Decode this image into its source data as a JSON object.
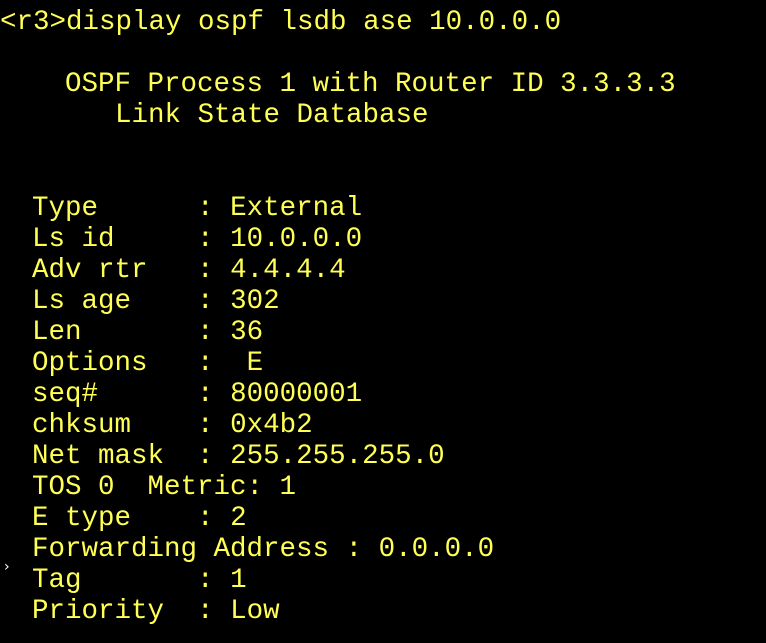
{
  "terminal": {
    "text_color": "#ffff55",
    "background": "#000000",
    "prompt": "<r3>",
    "command": "display ospf lsdb ase 10.0.0.0",
    "header": {
      "process_line": "OSPF Process 1 with Router ID 3.3.3.3",
      "db_title": "Link State Database"
    },
    "fields": [
      {
        "label": "Type      ",
        "sep": ":",
        "value": "External"
      },
      {
        "label": "Ls id     ",
        "sep": ":",
        "value": "10.0.0.0"
      },
      {
        "label": "Adv rtr   ",
        "sep": ":",
        "value": "4.4.4.4"
      },
      {
        "label": "Ls age    ",
        "sep": ":",
        "value": "302"
      },
      {
        "label": "Len       ",
        "sep": ":",
        "value": "36"
      },
      {
        "label": "Options   ",
        "sep": ":",
        "value": " E"
      },
      {
        "label": "seq#      ",
        "sep": ":",
        "value": "80000001"
      },
      {
        "label": "chksum    ",
        "sep": ":",
        "value": "0x4b2"
      },
      {
        "label": "Net mask  ",
        "sep": ":",
        "value": "255.255.255.0"
      }
    ],
    "tos_line": "TOS 0  Metric: 1",
    "fields2": [
      {
        "label": "E type    ",
        "sep": ":",
        "value": "2"
      },
      {
        "label": "Forwarding Address ",
        "sep": ":",
        "value": "0.0.0.0"
      },
      {
        "label": "Tag       ",
        "sep": ":",
        "value": "1"
      },
      {
        "label": "Priority  ",
        "sep": ":",
        "value": "Low"
      }
    ],
    "cursor_marker": "›"
  }
}
